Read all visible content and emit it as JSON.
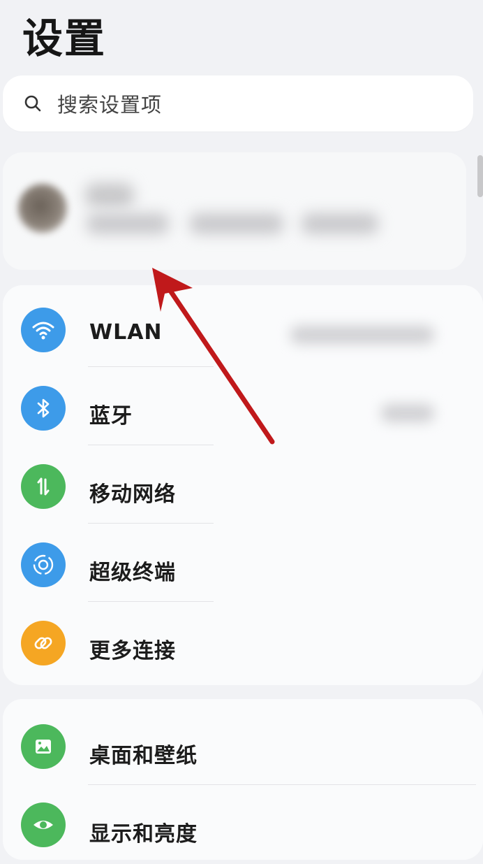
{
  "header": {
    "title": "设置"
  },
  "search": {
    "placeholder": "搜索设置项",
    "icon": "search-icon"
  },
  "connectivity": {
    "items": [
      {
        "label": "WLAN",
        "icon": "wifi-icon",
        "color": "#3d9be9"
      },
      {
        "label": "蓝牙",
        "icon": "bluetooth-icon",
        "color": "#3d9be9"
      },
      {
        "label": "移动网络",
        "icon": "mobile-network-icon",
        "color": "#4cb85c"
      },
      {
        "label": "超级终端",
        "icon": "super-device-icon",
        "color": "#3d9be9"
      },
      {
        "label": "更多连接",
        "icon": "link-icon",
        "color": "#f5a623"
      }
    ]
  },
  "display": {
    "items": [
      {
        "label": "桌面和壁纸",
        "icon": "wallpaper-icon",
        "color": "#4cb85c"
      },
      {
        "label": "显示和亮度",
        "icon": "eye-icon",
        "color": "#4cb85c"
      }
    ]
  },
  "annotation": {
    "arrow_color": "#c0191b"
  }
}
